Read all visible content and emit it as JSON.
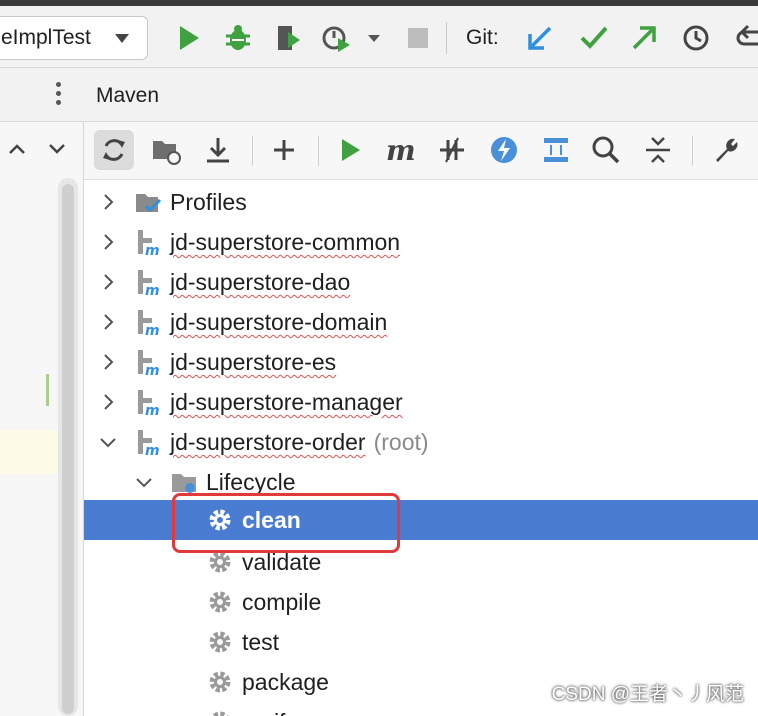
{
  "toolbar": {
    "run_config_label": "eImplTest",
    "git_label": "Git:"
  },
  "maven": {
    "title": "Maven",
    "tree": [
      {
        "label": "Profiles",
        "root_tag": ""
      },
      {
        "label": "jd-superstore-common",
        "root_tag": ""
      },
      {
        "label": "jd-superstore-dao",
        "root_tag": ""
      },
      {
        "label": "jd-superstore-domain",
        "root_tag": ""
      },
      {
        "label": "jd-superstore-es",
        "root_tag": ""
      },
      {
        "label": "jd-superstore-manager",
        "root_tag": ""
      },
      {
        "label": "jd-superstore-order",
        "root_tag": "(root)"
      },
      {
        "label": "Lifecycle",
        "root_tag": ""
      },
      {
        "label": "clean",
        "root_tag": ""
      },
      {
        "label": "validate",
        "root_tag": ""
      },
      {
        "label": "compile",
        "root_tag": ""
      },
      {
        "label": "test",
        "root_tag": ""
      },
      {
        "label": "package",
        "root_tag": ""
      },
      {
        "label": "verify",
        "root_tag": ""
      }
    ]
  },
  "watermark": "CSDN @王者丶丿风范",
  "colors": {
    "selection": "#4a7dd1",
    "annotation": "#e03a3a",
    "run_green": "#3fa13f",
    "git_blue": "#2f8fe0"
  },
  "icons": [
    "chevron-right-icon",
    "chevron-down-icon",
    "maven-module-icon",
    "gear-icon",
    "folder-icon",
    "profiles-icon"
  ]
}
